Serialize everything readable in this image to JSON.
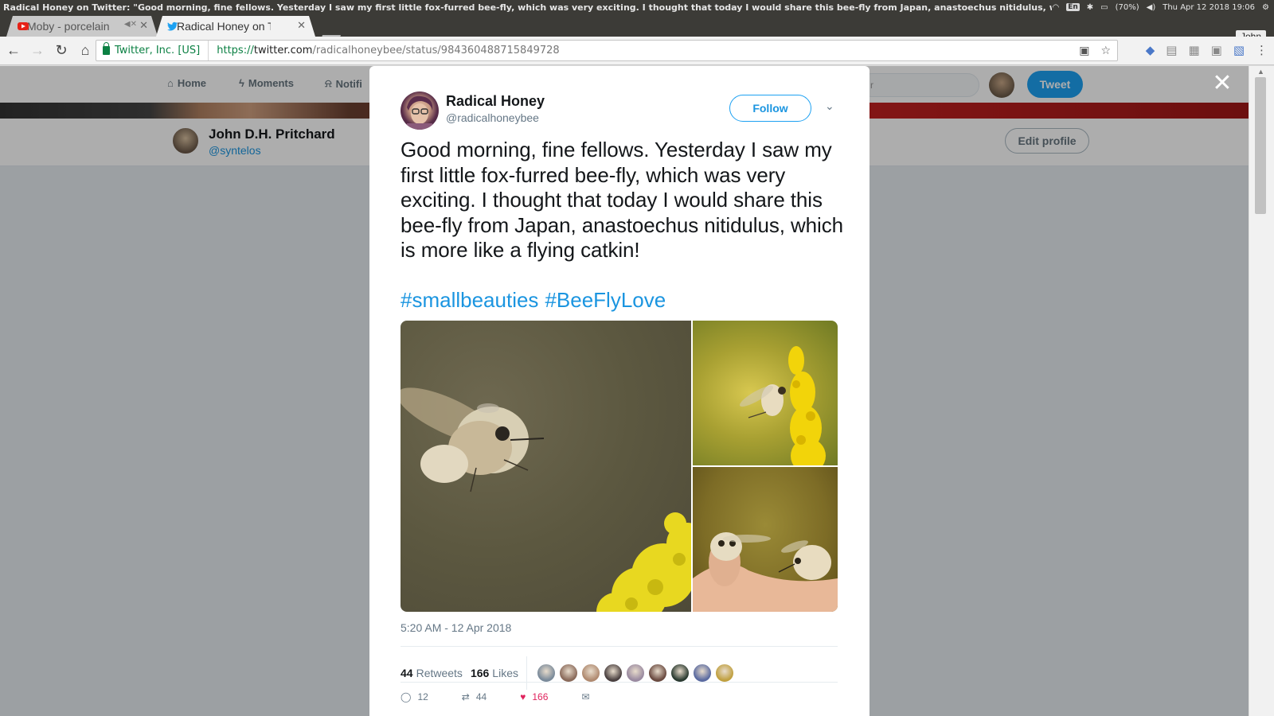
{
  "system_panel": {
    "window_title": "Radical Honey on Twitter: \"Good morning, fine fellows. Yesterday I saw my first little fox-furred bee-fly, which was very exciting. I thought that today I would share this bee-fly from Japan, anastoechus nitidulus, which is more like a flying catkin!",
    "keyboard": "En",
    "battery": "(70%)",
    "clock": "Thu Apr 12 2018 19:06"
  },
  "browser": {
    "user": "John",
    "tabs": [
      {
        "label": "Moby - porcelain",
        "active": false
      },
      {
        "label": "Radical Honey on Twitter",
        "active": true
      }
    ],
    "security_label": "Twitter, Inc. [US]",
    "url": {
      "scheme": "https://",
      "host": "twitter.com",
      "path": "/radicalhoneybee/status/984360488715849728"
    }
  },
  "twitter_page": {
    "nav": {
      "home": "Home",
      "moments": "Moments",
      "notifications": "Notifi",
      "search_placeholder": "r",
      "tweet_button": "Tweet"
    },
    "profile": {
      "name": "John D.H. Pritchard",
      "handle": "@syntelos",
      "edit_button": "Edit profile"
    }
  },
  "tweet": {
    "author_name": "Radical Honey",
    "author_handle": "@radicalhoneybee",
    "follow_label": "Follow",
    "text": "Good morning, fine fellows. Yesterday I saw my first little fox-furred bee-fly, which was very exciting. I thought that today I would share this bee-fly from Japan, anastoechus nitidulus, which is more like a flying catkin!",
    "hashtags": [
      "#smallbeauties",
      "#BeeFlyLove"
    ],
    "timestamp": "5:20 AM - 12 Apr 2018",
    "retweets_count": "44",
    "retweets_label": "Retweets",
    "likes_count": "166",
    "likes_label": "Likes",
    "actions": {
      "replies": "12",
      "retweets": "44",
      "likes": "166"
    },
    "liker_colors": [
      "#7a8a9a",
      "#8a6a5a",
      "#b08a70",
      "#4a4040",
      "#9a8aa0",
      "#6a4a40",
      "#2a3a30",
      "#5a6aa0",
      "#c0a040"
    ]
  },
  "colors": {
    "twitter_blue": "#1da1f2",
    "link_blue": "#1b95e0",
    "like_red": "#e0245e"
  }
}
